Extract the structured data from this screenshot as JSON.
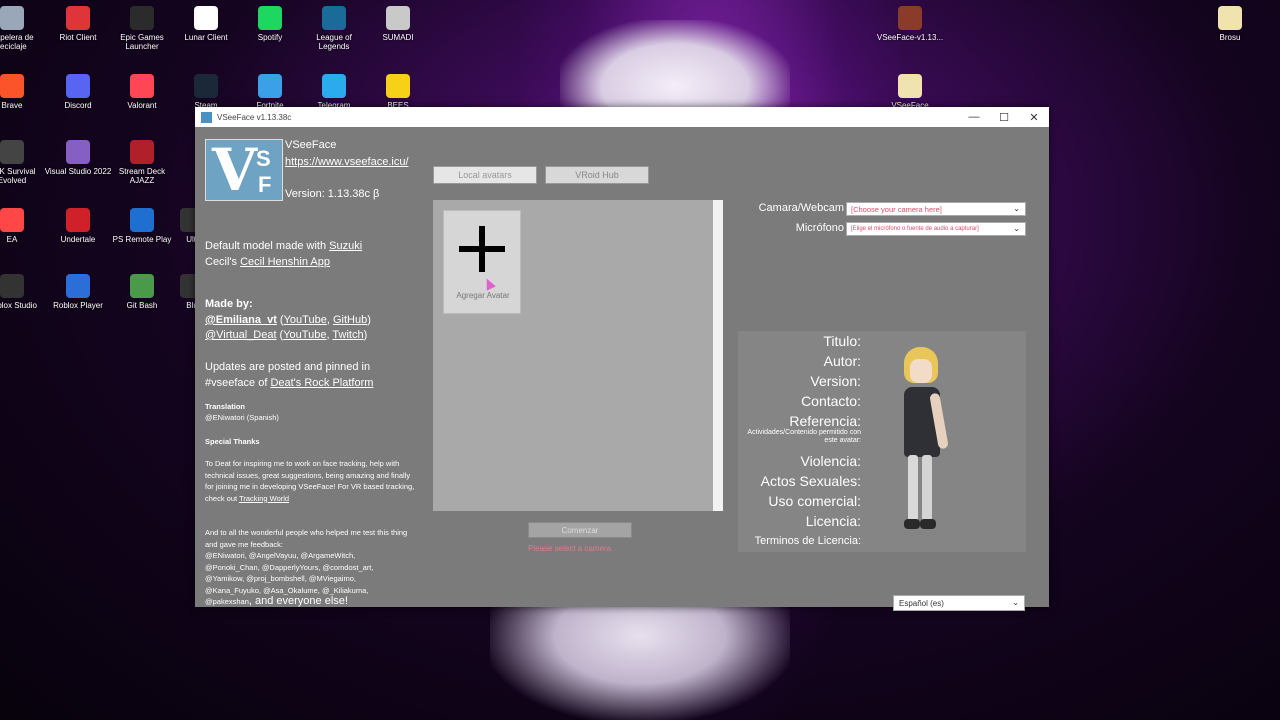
{
  "desktop": {
    "icons": [
      {
        "label": "Papelera de reciclaje",
        "color": "#9aa7b8"
      },
      {
        "label": "Riot Client",
        "color": "#e0343b"
      },
      {
        "label": "Epic Games Launcher",
        "color": "#2b2b2b"
      },
      {
        "label": "Lunar Client",
        "color": "#ffffff"
      },
      {
        "label": "Spotify",
        "color": "#1ed760"
      },
      {
        "label": "League of Legends",
        "color": "#1a6a9a"
      },
      {
        "label": "SUMADI",
        "color": "#c9c9c9"
      },
      {
        "label": "VSeeFace-v1.13...",
        "color": "#8a3b2a"
      },
      {
        "label": "Brosu",
        "color": "#f1e3b0"
      },
      {
        "label": "Brave",
        "color": "#fb542b"
      },
      {
        "label": "Discord",
        "color": "#5865f2"
      },
      {
        "label": "Valorant",
        "color": "#ff4655"
      },
      {
        "label": "Steam",
        "color": "#1b2838"
      },
      {
        "label": "Fortnite",
        "color": "#3aa0e8"
      },
      {
        "label": "Telegram",
        "color": "#2aabee"
      },
      {
        "label": "BEES",
        "color": "#f7d117"
      },
      {
        "label": "VSeeFace",
        "color": "#f1e3b0"
      },
      {
        "label": "ARK Survival Evolved",
        "color": "#444444"
      },
      {
        "label": "Visual Studio 2022",
        "color": "#865fc5"
      },
      {
        "label": "Stream Deck AJAZZ",
        "color": "#b0202a"
      },
      {
        "label": "EA",
        "color": "#ff4747"
      },
      {
        "label": "Undertale",
        "color": "#d0202a"
      },
      {
        "label": "PS Remote Play",
        "color": "#1f6fd0"
      },
      {
        "label": "Ulti",
        "color": "#333333"
      },
      {
        "label": "Roblox Studio",
        "color": "#333333"
      },
      {
        "label": "Roblox Player",
        "color": "#2b6ed8"
      },
      {
        "label": "Git Bash",
        "color": "#4a9a4a"
      },
      {
        "label": "Blu",
        "color": "#333333"
      }
    ]
  },
  "window": {
    "title": "VSeeFace v1.13.38c",
    "minimize": "—",
    "maximize": "☐",
    "close": "✕"
  },
  "left": {
    "app_name": "VSeeFace",
    "url": "https://www.vseeface.icu/",
    "version": "Version: 1.13.38c β",
    "default_model_prefix": "Default model made with ",
    "suzuki": "Suzuki",
    "cecil_s": "Cecil",
    "cecil_suffix": "'s ",
    "henshin": "Cecil Henshin App",
    "made_by": "Made by:",
    "emiliana": "@Emiliana_vt",
    "youtube1": "YouTube",
    "github": "GitHub",
    "virtual_deat": "@Virtual_Deat",
    "youtube2": "YouTube",
    "twitch": "Twitch",
    "updates_line1": "Updates are posted and pinned in",
    "updates_line2_prefix": "#vseeface of ",
    "deats_rock": "Deat's Rock Platform",
    "translation_head": "Translation",
    "translation_body": "@ENiwatori (Spanish)",
    "special_head": "Special Thanks",
    "thanks_text": "To Deat for inspiring me to work on face tracking, help with technical issues, great suggestions, being amazing and finally for joining me in developing VSeeFace! For VR based tracking, check out",
    "tracking_world": "Tracking World",
    "thanks2": "And to all the wonderful people who helped me test this thing and gave me feedback:",
    "names1": "@ENiwatori, @AngelVayuu, @ArgameWitch,",
    "names2": "@Ponoki_Chan, @DapperlyYours, @comdost_art,",
    "names3": "@Yamikow, @proj_bombshell, @MViegaimo,",
    "names4": "@Kana_Fuyuko, @Asa_Okalume, @_Kiliakuma,",
    "names5": "@pakexshan",
    "everyone": ", and everyone else!"
  },
  "tabs": {
    "local": "Local avatars",
    "vroid": "VRoid Hub"
  },
  "avatar": {
    "add_label": "Agregar Avatar"
  },
  "start": {
    "button": "Comenzar",
    "warning": "Please select a camera"
  },
  "devices": {
    "camera_label": "Camara/Webcam",
    "camera_value": "[Choose your camera here]",
    "mic_label": "Micrófono",
    "mic_value": "[Elige el micrófono o fuente de audio a capturar]"
  },
  "info": {
    "titulo": "Titulo:",
    "autor": "Autor:",
    "version": "Version:",
    "contacto": "Contacto:",
    "referencia": "Referencia:",
    "actividades": "Actividades/Contenido permitido con este avatar:",
    "violencia": "Violencia:",
    "actos": "Actos Sexuales:",
    "uso": "Uso comercial:",
    "licencia": "Licencia:",
    "terminos": "Terminos de Licencia:"
  },
  "language": {
    "value": "Español (es)"
  }
}
